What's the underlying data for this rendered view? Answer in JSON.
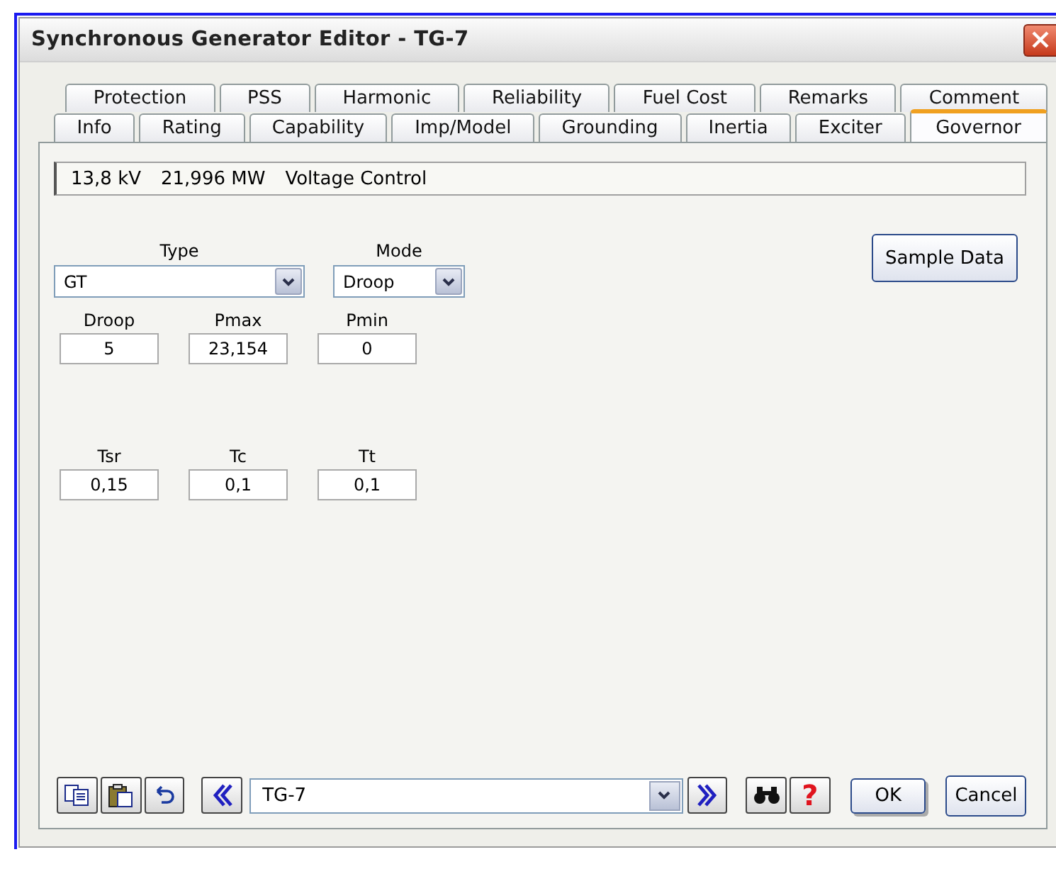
{
  "window": {
    "title": "Synchronous Generator Editor - TG-7"
  },
  "tab_rows": [
    [
      {
        "label": "Protection",
        "selected": false
      },
      {
        "label": "PSS",
        "selected": false
      },
      {
        "label": "Harmonic",
        "selected": false
      },
      {
        "label": "Reliability",
        "selected": false
      },
      {
        "label": "Fuel Cost",
        "selected": false
      },
      {
        "label": "Remarks",
        "selected": false
      },
      {
        "label": "Comment",
        "selected": false
      }
    ],
    [
      {
        "label": "Info",
        "selected": false
      },
      {
        "label": "Rating",
        "selected": false
      },
      {
        "label": "Capability",
        "selected": false
      },
      {
        "label": "Imp/Model",
        "selected": false
      },
      {
        "label": "Grounding",
        "selected": false
      },
      {
        "label": "Inertia",
        "selected": false
      },
      {
        "label": "Exciter",
        "selected": false
      },
      {
        "label": "Governor",
        "selected": true
      }
    ]
  ],
  "info_bar": [
    "13,8 kV",
    "21,996 MW",
    "Voltage Control"
  ],
  "dropdowns": [
    {
      "label": "Type",
      "value": "GT"
    },
    {
      "label": "Mode",
      "value": "Droop"
    }
  ],
  "sample_button": "Sample Data",
  "field_rows": [
    [
      {
        "label": "Droop",
        "value": "5"
      },
      {
        "label": "Pmax",
        "value": "23,154"
      },
      {
        "label": "Pmin",
        "value": "0"
      }
    ],
    [
      {
        "label": "Tsr",
        "value": "0,15"
      },
      {
        "label": "Tc",
        "value": "0,1"
      },
      {
        "label": "Tt",
        "value": "0,1"
      }
    ]
  ],
  "toolbar": {
    "record": "TG-7",
    "help": "?",
    "ok": "OK",
    "cancel": "Cancel"
  }
}
